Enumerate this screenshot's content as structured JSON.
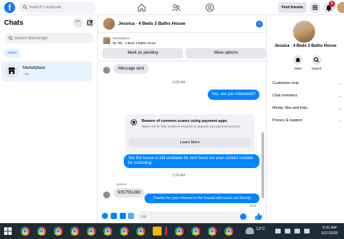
{
  "topbar": {
    "search_placeholder": "Search Facebook",
    "find_friends_label": "Find friends",
    "notification_count": "1"
  },
  "left": {
    "title": "Chats",
    "search_placeholder": "Search Messenger",
    "inbox_label": "Inbox",
    "threads": [
      {
        "name": "Marketplace",
        "time": "· 1m"
      }
    ]
  },
  "chat": {
    "header_name": "Jessica · 4 Beds 3 Baths House",
    "listing_category": "Marketplace",
    "listing_desc": "$1,795 · 4 Beds 3 Baths House",
    "mark_pending_label": "Mark as pending",
    "more_options_label": "More options",
    "messages": {
      "sent_notice": "Message sent",
      "time1": "4:09 AM",
      "out1": "Yes, are you interested?",
      "scam_title": "Beware of common scams using payment apps",
      "scam_body": "Watch out for fake emails or requests to upgrade your payment account.",
      "learn_more": "Learn More",
      "out2": "Yes the house is still available for rent Send me your contact number for schduling",
      "time2": "5:30 AM",
      "sender_name": "Jessica",
      "in1": "5057551383",
      "out3": "Thanks for your interest in the housel will reach out Shortly",
      "status": "Sent"
    },
    "composer_placeholder": "Aa"
  },
  "right": {
    "name": "Jessica · 4 Beds 3 Baths House",
    "actions": [
      "Mute",
      "Search"
    ],
    "menu": [
      "Customize chat",
      "Chat members",
      "Media, files and links",
      "Privacy & support"
    ]
  },
  "taskbar": {
    "temperature": "13°C",
    "time": "5:31 AM",
    "date": "3/27/2025"
  },
  "colors": {
    "accent": "#1877f2",
    "bubble_out": "#0084ff",
    "bubble_in": "#e4e6eb",
    "taskbar": "#1f2b36"
  }
}
